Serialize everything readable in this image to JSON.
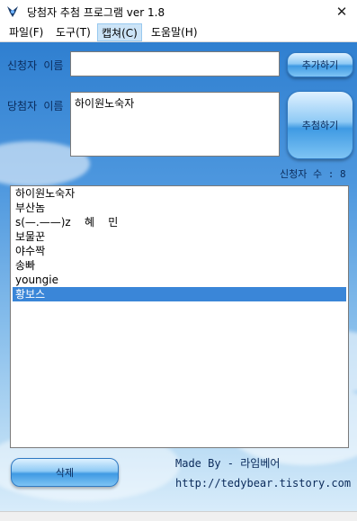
{
  "window": {
    "title": "당첨자 추첨 프로그램 ver 1.8",
    "close_glyph": "✕"
  },
  "menu": [
    {
      "label": "파일(F)",
      "name": "menu-file"
    },
    {
      "label": "도구(T)",
      "name": "menu-tools"
    },
    {
      "label": "캡쳐(C)",
      "name": "menu-capture",
      "active": true
    },
    {
      "label": "도움말(H)",
      "name": "menu-help"
    }
  ],
  "form": {
    "applicant_label": "신청자 이름",
    "applicant_value": "",
    "add_button": "추가하기",
    "winner_label": "당첨자 이름",
    "winner_value": "하이원노숙자",
    "draw_button": "추첨하기",
    "applicant_count_label": "신청자 수 : 8"
  },
  "applicants": [
    "하이원노숙자",
    "부산놈",
    "s(—.——)z    혜    민",
    "보물꾼",
    "야수짝",
    "송빠",
    "youngie",
    "황보스"
  ],
  "selected_index": 7,
  "footer": {
    "delete_button": "삭제",
    "made_by": "Made By - 라임베어",
    "url": "http://tedybear.tistory.com"
  },
  "colors": {
    "selection": "#3a86d8",
    "sky_top": "#2f7fd0",
    "sky_bottom": "#d8ecfa"
  }
}
